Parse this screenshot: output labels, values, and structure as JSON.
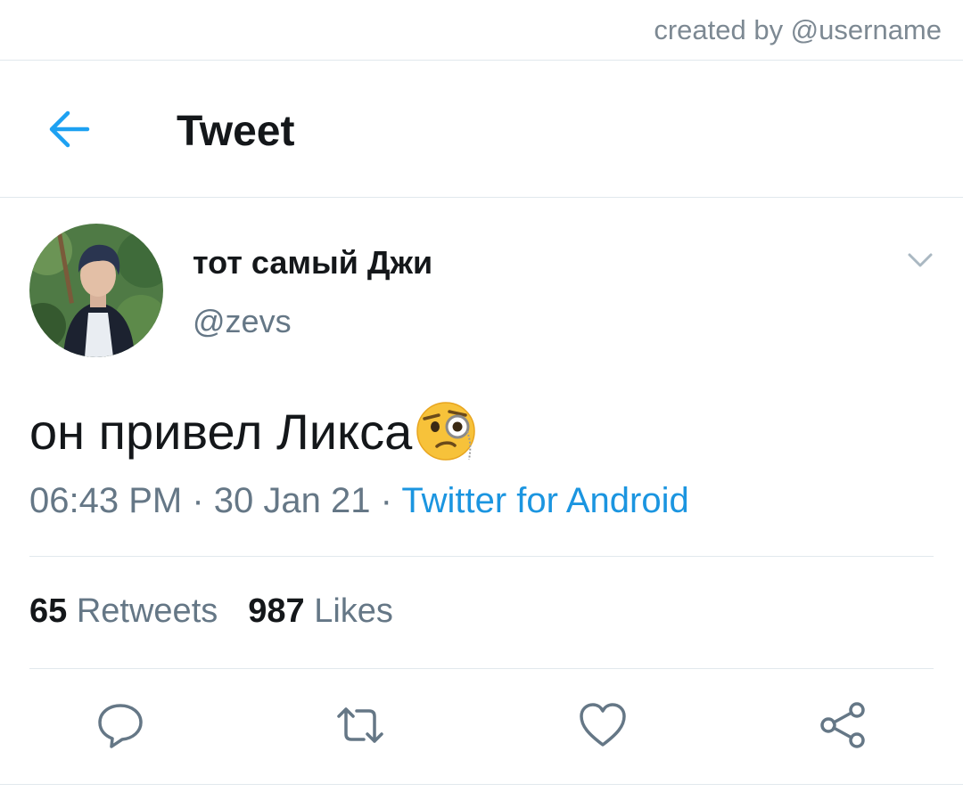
{
  "credit": {
    "text": "created by @username"
  },
  "header": {
    "title": "Tweet",
    "back_icon": "arrow-left-icon"
  },
  "tweet": {
    "display_name": "тот самый Джи",
    "handle": "@zevs",
    "text": "он привел Ликса",
    "emoji": "face-with-monocle",
    "time": "06:43 PM",
    "separator": "·",
    "date": "30 Jan 21",
    "source": "Twitter for Android",
    "retweets_count": "65",
    "retweets_label": "Retweets",
    "likes_count": "987",
    "likes_label": "Likes"
  },
  "actions": [
    {
      "icon": "reply-icon"
    },
    {
      "icon": "retweet-icon"
    },
    {
      "icon": "heart-icon"
    },
    {
      "icon": "share-icon"
    }
  ],
  "colors": {
    "accent": "#1b95e0",
    "secondary_text": "#657786",
    "divider": "#e1e8ed"
  }
}
